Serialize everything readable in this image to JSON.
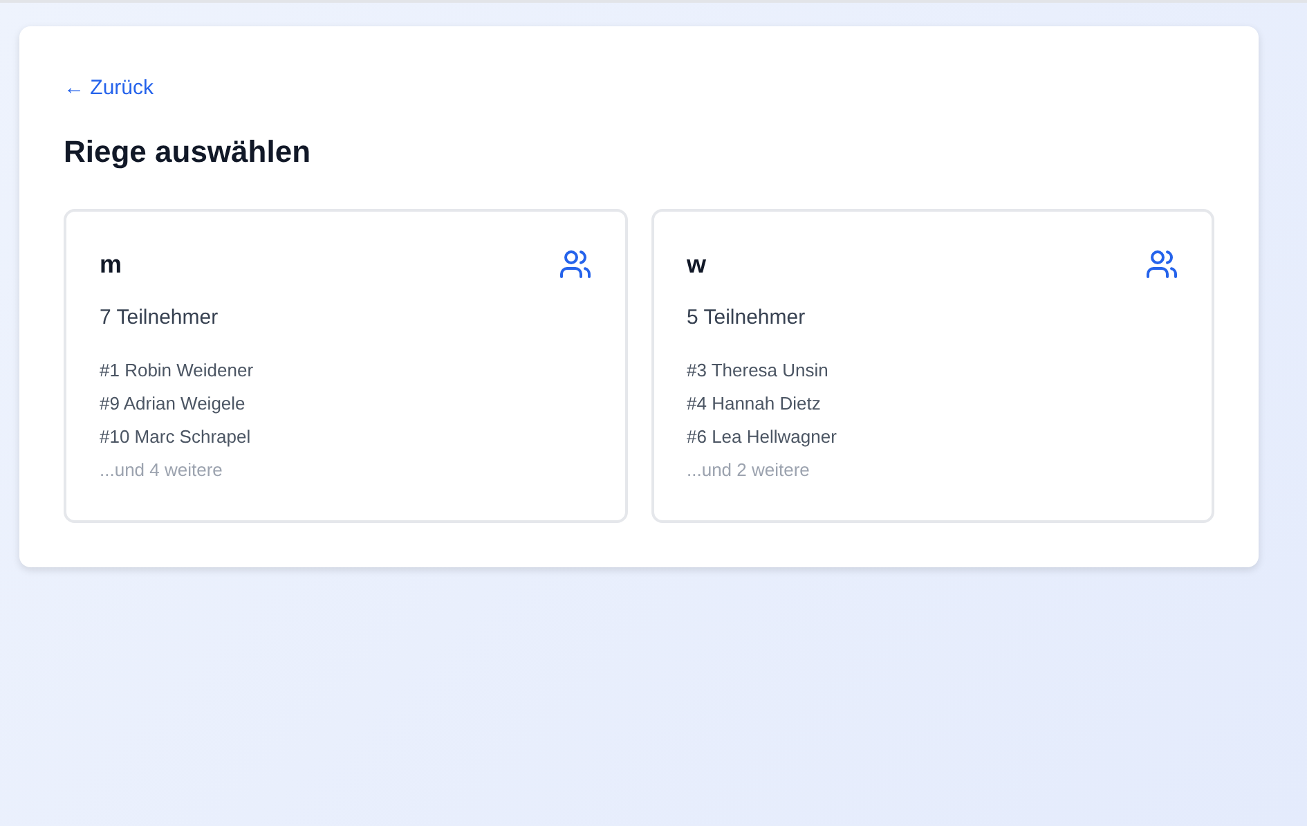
{
  "back_link": "← Zurück",
  "title": "Riege auswählen",
  "groups": [
    {
      "name": "m",
      "count": "7 Teilnehmer",
      "members": [
        "#1 Robin Weidener",
        "#9 Adrian Weigele",
        "#10 Marc Schrapel"
      ],
      "more": "...und 4 weitere"
    },
    {
      "name": "w",
      "count": "5 Teilnehmer",
      "members": [
        "#3 Theresa Unsin",
        "#4 Hannah Dietz",
        "#6 Lea Hellwagner"
      ],
      "more": "...und 2 weitere"
    }
  ]
}
